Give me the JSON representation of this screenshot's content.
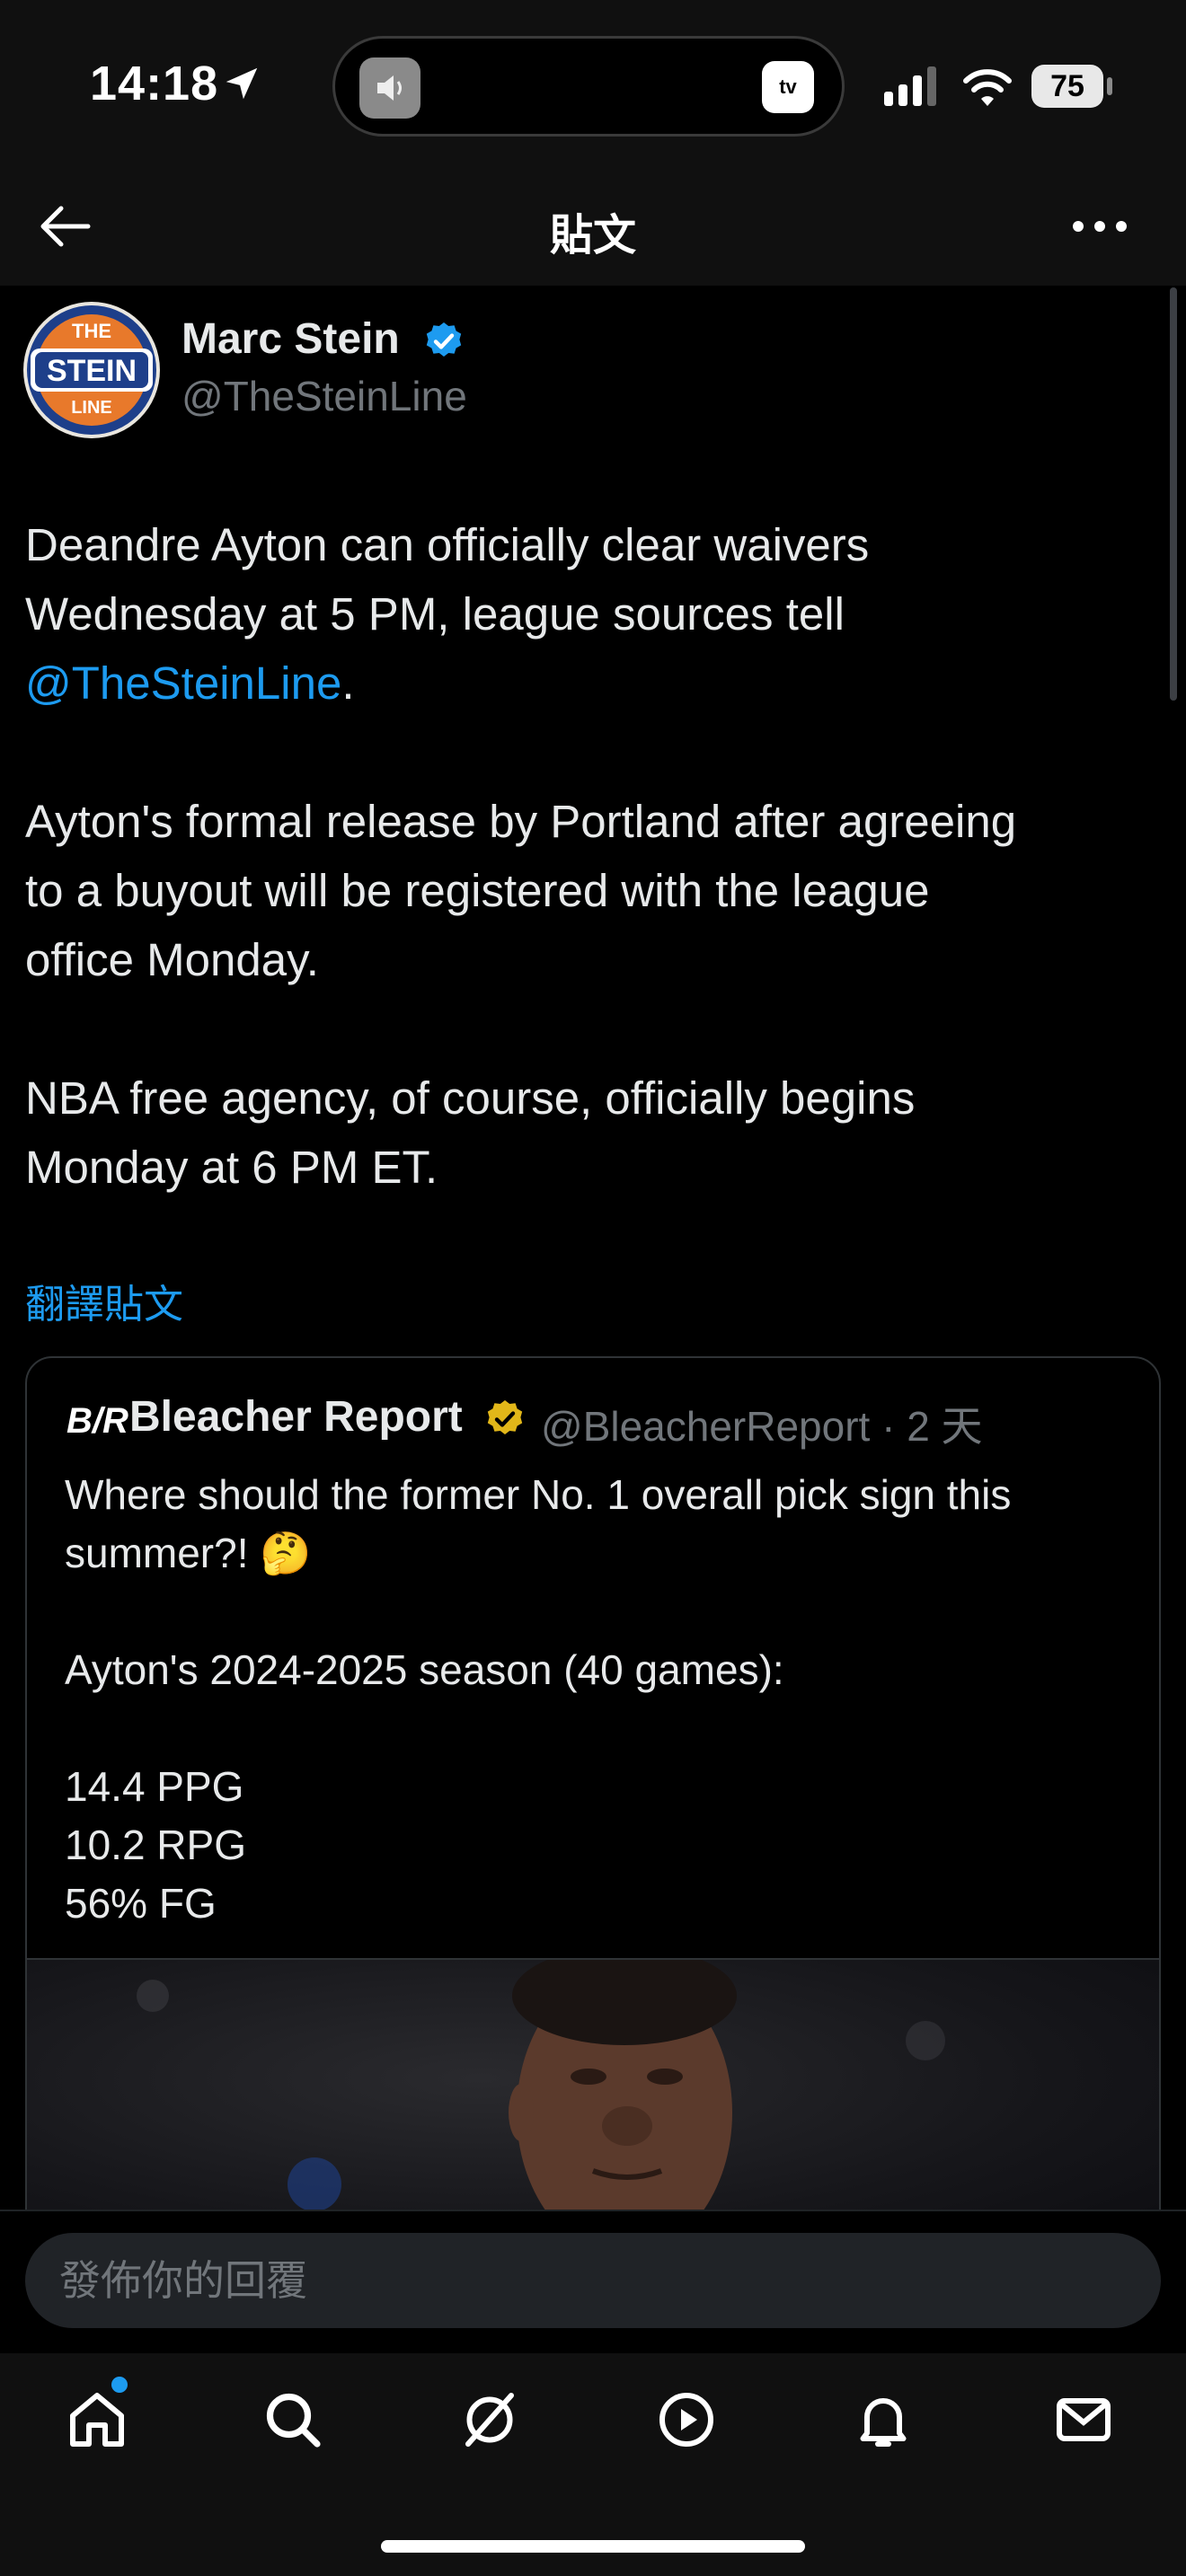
{
  "status_bar": {
    "time": "14:18",
    "tv_label": "tv",
    "battery": "75"
  },
  "header": {
    "title": "貼文"
  },
  "tweet": {
    "author_name": "Marc Stein",
    "author_handle": "@TheSteinLine",
    "avatar_lines": [
      "THE",
      "STEIN",
      "LINE"
    ],
    "p1_line1": "Deandre Ayton can officially clear waivers",
    "p1_line2": "Wednesday at 5 PM, league sources tell",
    "p1_mention": "@TheSteinLine",
    "p1_end": ".",
    "p2_line1": "Ayton's formal release by Portland after agreeing",
    "p2_line2": "to a buyout will be registered with the league",
    "p2_line3": "office Monday.",
    "p3_line1": "NBA free agency, of course, officially begins",
    "p3_line2": "Monday at 6 PM ET.",
    "translate": "翻譯貼文"
  },
  "quote": {
    "logo": "B/R",
    "name": "Bleacher Report",
    "handle_time": "@BleacherReport · 2 天",
    "line1": "Where should the former No. 1 overall pick sign this",
    "line2": "summer?! 🤔",
    "line3": "Ayton's 2024-2025 season (40 games):",
    "line4": "14.4 PPG",
    "line5": "10.2 RPG",
    "line6": "56% FG"
  },
  "reply": {
    "placeholder": "發佈你的回覆"
  },
  "nav": {
    "icons": [
      "home-icon",
      "search-icon",
      "grok-icon",
      "video-icon",
      "notifications-icon",
      "messages-icon"
    ]
  },
  "colors": {
    "accent": "#1d9bf0",
    "background": "#000000",
    "muted": "#71767b",
    "verified": "#1d9bf0",
    "gold_verified": "#e2b719"
  }
}
